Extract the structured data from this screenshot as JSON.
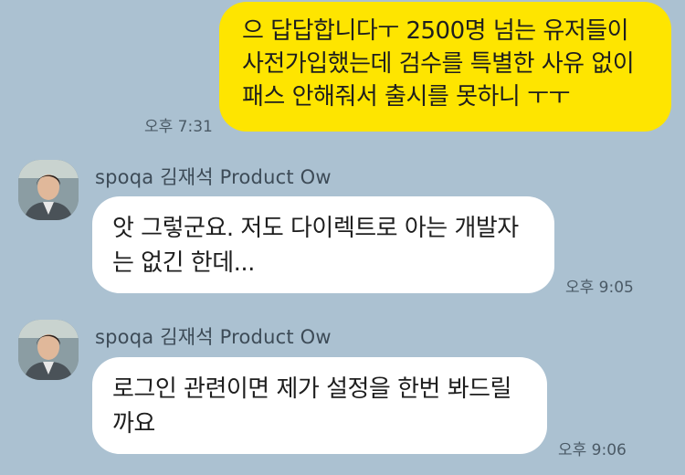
{
  "messages": [
    {
      "direction": "outgoing",
      "lines": [
        "으 답답합니다ㅜ 2500명 넘는 유저들이",
        "사전가입했는데 검수를 특별한 사유 없이",
        "패스 안해줘서 출시를 못하니 ㅜㅜ"
      ],
      "time": "오후 7:31"
    },
    {
      "direction": "incoming",
      "sender": "spoqa 김재석 Product Ow",
      "avatar_icon": "profile-photo",
      "lines": [
        "앗 그렇군요. 저도 다이렉트로 아는 개발자",
        "는 없긴 한데..."
      ],
      "time": "오후 9:05"
    },
    {
      "direction": "incoming",
      "sender": "spoqa 김재석 Product Ow",
      "avatar_icon": "profile-photo",
      "lines": [
        "로그인 관련이면 제가 설정을 한번 봐드릴",
        "까요"
      ],
      "time": "오후 9:06"
    }
  ],
  "colors": {
    "background": "#abc1d1",
    "outgoing_bubble": "#fee500",
    "incoming_bubble": "#ffffff"
  }
}
